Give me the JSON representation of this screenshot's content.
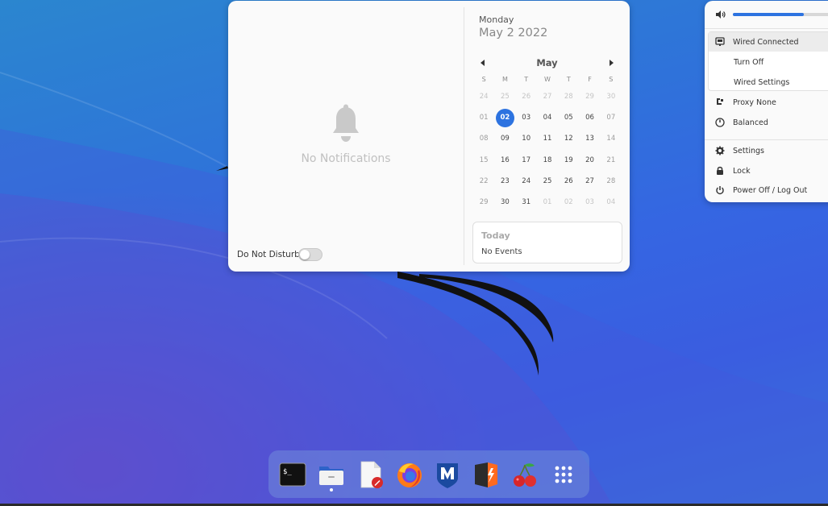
{
  "date_menu": {
    "notifications": {
      "empty_text": "No Notifications",
      "dnd_label": "Do Not Disturb",
      "dnd_enabled": false
    },
    "calendar": {
      "weekday": "Monday",
      "date": "May 2 2022",
      "month": "May",
      "day_headers": [
        "S",
        "M",
        "T",
        "W",
        "T",
        "F",
        "S"
      ],
      "weeks": [
        [
          "24",
          "25",
          "26",
          "27",
          "28",
          "29",
          "30"
        ],
        [
          "01",
          "02",
          "03",
          "04",
          "05",
          "06",
          "07"
        ],
        [
          "08",
          "09",
          "10",
          "11",
          "12",
          "13",
          "14"
        ],
        [
          "15",
          "16",
          "17",
          "18",
          "19",
          "20",
          "21"
        ],
        [
          "22",
          "23",
          "24",
          "25",
          "26",
          "27",
          "28"
        ],
        [
          "29",
          "30",
          "31",
          "01",
          "02",
          "03",
          "04"
        ]
      ],
      "selected_day": "02"
    },
    "events": {
      "heading": "Today",
      "empty_text": "No Events"
    }
  },
  "system_menu": {
    "volume_level": 0.68,
    "network": {
      "title": "Wired Connected",
      "items": [
        "Turn Off",
        "Wired Settings"
      ]
    },
    "proxy": "Proxy None",
    "power_mode": "Balanced",
    "actions": [
      "Settings",
      "Lock",
      "Power Off / Log Out"
    ]
  },
  "dash": {
    "apps": [
      {
        "icon": "terminal-icon"
      },
      {
        "icon": "files-icon",
        "running": true
      },
      {
        "icon": "text-editor-icon"
      },
      {
        "icon": "firefox-icon"
      },
      {
        "icon": "metasploit-icon"
      },
      {
        "icon": "burp-suite-icon"
      },
      {
        "icon": "cherrytree-icon"
      },
      {
        "icon": "show-apps-icon"
      }
    ]
  },
  "colors": {
    "accent": "#2d73e0",
    "wallpaper": "#3a66e0"
  }
}
